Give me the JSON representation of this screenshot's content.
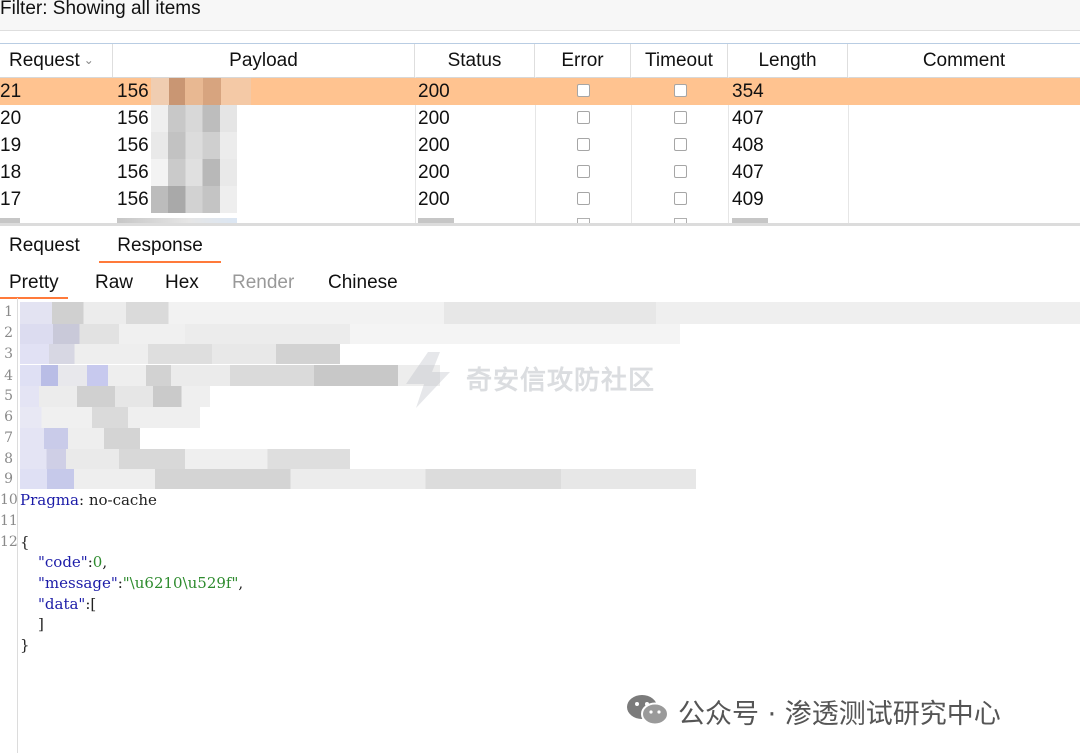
{
  "filter": {
    "label": "Filter: Showing all items"
  },
  "table": {
    "columns": [
      "Request",
      "Payload",
      "Status",
      "Error",
      "Timeout",
      "Length",
      "Comment"
    ],
    "rows": [
      {
        "request": "21",
        "payload": "156",
        "status": "200",
        "error": false,
        "timeout": false,
        "length": "354",
        "comment": "",
        "selected": true
      },
      {
        "request": "20",
        "payload": "156",
        "status": "200",
        "error": false,
        "timeout": false,
        "length": "407",
        "comment": ""
      },
      {
        "request": "19",
        "payload": "156",
        "status": "200",
        "error": false,
        "timeout": false,
        "length": "408",
        "comment": ""
      },
      {
        "request": "18",
        "payload": "156",
        "status": "200",
        "error": false,
        "timeout": false,
        "length": "407",
        "comment": ""
      },
      {
        "request": "17",
        "payload": "156",
        "status": "200",
        "error": false,
        "timeout": false,
        "length": "409",
        "comment": ""
      }
    ]
  },
  "tabs_top": [
    "Request",
    "Response"
  ],
  "tabs_view": [
    "Pretty",
    "Raw",
    "Hex",
    "Render",
    "Chinese"
  ],
  "editor": {
    "line_numbers": [
      "1",
      "2",
      "3",
      "4",
      "5",
      "6",
      "7",
      "8",
      "9",
      "10",
      "11",
      "12"
    ],
    "header_line": {
      "name": "Pragma",
      "value": " no-cache"
    },
    "json_open": "{",
    "json_code_key": "\"code\"",
    "json_code_val": "0",
    "json_message_key": "\"message\"",
    "json_message_val": "\"\\u6210\\u529f\"",
    "json_data_key": "\"data\"",
    "json_data_open": "[",
    "json_data_close": "]",
    "json_close": "}"
  },
  "watermarks": {
    "qianxin": "奇安信攻防社区",
    "wechat": "公众号 · 渗透测试研究中心"
  },
  "colors": {
    "selected_row": "#ffc390",
    "active_tab_underline": "#ff7a3a",
    "json_key": "#1c1ca8",
    "json_value": "#2e8b2e"
  }
}
